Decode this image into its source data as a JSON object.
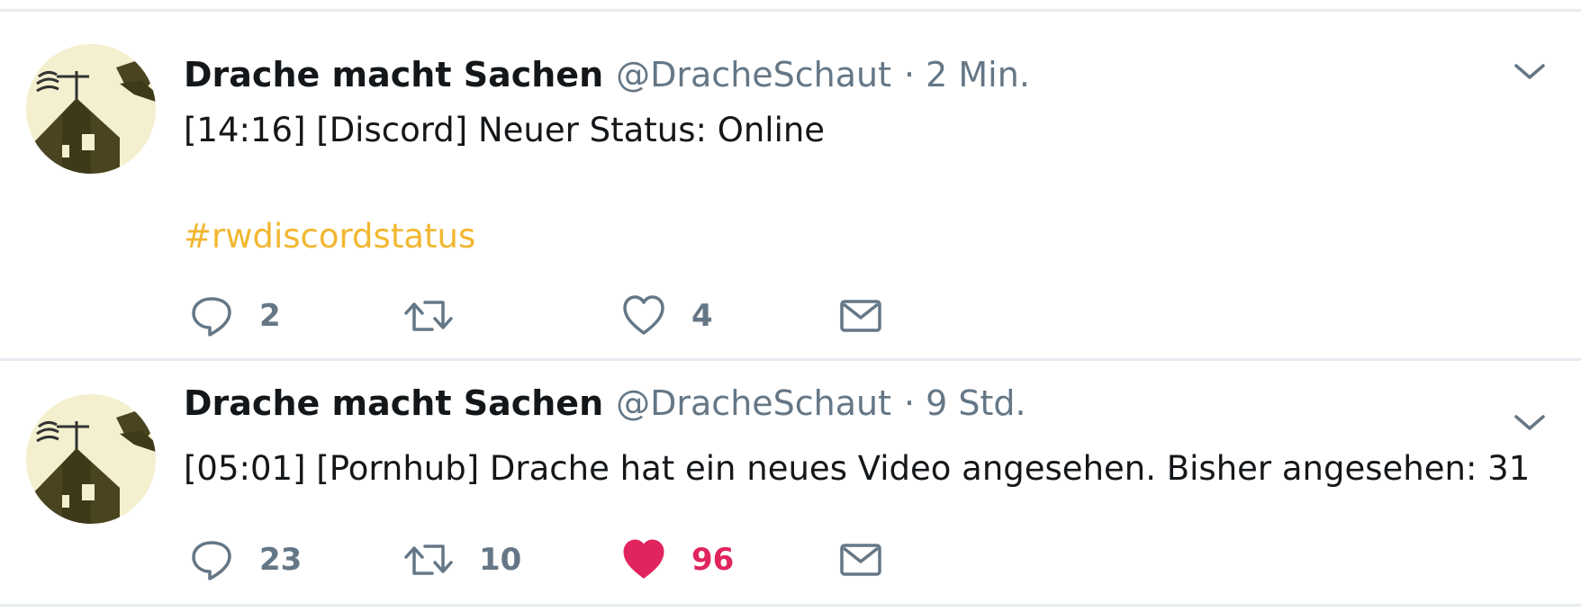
{
  "colors": {
    "text": "#14171a",
    "secondary": "#657786",
    "hashtag": "#f2b731",
    "like_active": "#e0245e",
    "divider": "#e6ecf0"
  },
  "tweets": [
    {
      "author_name": "Drache macht Sachen",
      "handle": "@DracheSchaut",
      "separator": "·",
      "time": "2 Min.",
      "text": "[14:16] [Discord] Neuer Status: Online",
      "hashtag": "#rwdiscordstatus",
      "reply_count": "2",
      "retweet_count": "",
      "like_count": "4",
      "liked": false,
      "icons": [
        "reply-icon",
        "retweet-icon",
        "heart-icon",
        "mail-icon",
        "chevron-down-icon"
      ]
    },
    {
      "author_name": "Drache macht Sachen",
      "handle": "@DracheSchaut",
      "separator": "·",
      "time": "9 Std.",
      "text": "[05:01] [Pornhub] Drache hat ein neues Video angesehen. Bisher angesehen: 31",
      "hashtag": "",
      "reply_count": "23",
      "retweet_count": "10",
      "like_count": "96",
      "liked": true,
      "icons": [
        "reply-icon",
        "retweet-icon",
        "heart-filled-icon",
        "mail-icon",
        "chevron-down-icon"
      ]
    }
  ]
}
